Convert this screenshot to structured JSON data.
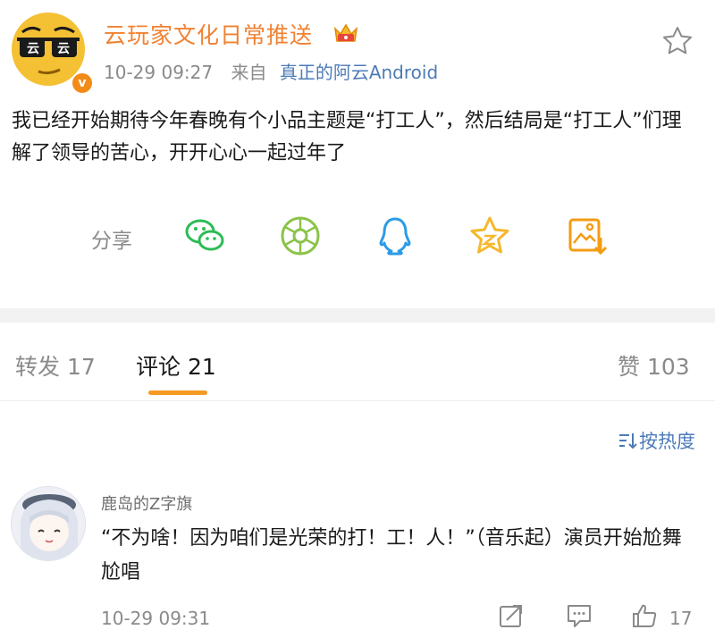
{
  "post": {
    "username": "云玩家文化日常推送",
    "avatar_text_left": "云",
    "avatar_text_right": "云",
    "verified_mark": "v",
    "time": "10-29 09:27",
    "source_prefix": "来自",
    "source": "真正的阿云Android",
    "content": "我已经开始期待今年春晚有个小品主题是“打工人”，然后结局是“打工人”们理解了领导的苦心，开开心心一起过年了",
    "icons": {
      "favorite": "star-outline-icon",
      "vip": "crown-badge-icon"
    }
  },
  "share": {
    "label": "分享",
    "targets": [
      "wechat-icon",
      "moments-icon",
      "qq-icon",
      "qzone-icon",
      "save-image-icon"
    ],
    "colors": {
      "wechat": "#2dbb55",
      "moments": "#8bc34a",
      "qq": "#2b9be6",
      "qzone": "#f5b82e",
      "save": "#f39c12"
    }
  },
  "tabs": {
    "repost": "转发 17",
    "comments": "评论 21",
    "likes": "赞 103"
  },
  "sort": {
    "label": "按热度"
  },
  "comment": {
    "username": "鹿岛的Z字旗",
    "text": "“不为啥！因为咱们是光荣的打！工！人！”（音乐起）演员开始尬舞尬唱",
    "time": "10-29 09:31",
    "like_count": "17"
  },
  "colors": {
    "username_orange": "#f08232",
    "link_blue": "#4c7bb7",
    "accent_underline": "#f59a23",
    "muted_gray": "#8a8a8a"
  }
}
